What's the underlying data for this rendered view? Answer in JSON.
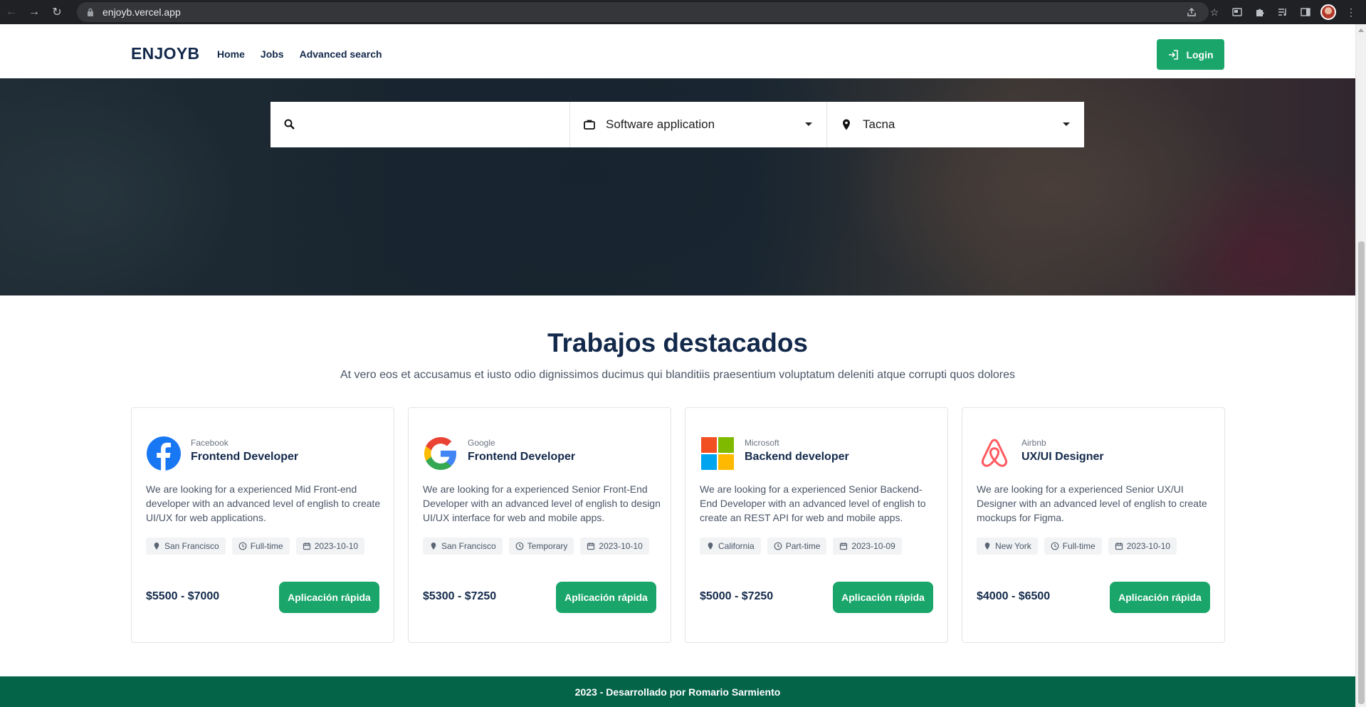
{
  "browser": {
    "url": "enjoyb.vercel.app",
    "icons": [
      "back-icon",
      "forward-icon",
      "reload-icon",
      "lock-icon",
      "share-icon",
      "star-icon",
      "tab-icon",
      "extensions-icon",
      "media-icon",
      "sidebar-icon",
      "profile-avatar",
      "menu-icon"
    ]
  },
  "navbar": {
    "brand": "ENJOYB",
    "links": [
      "Home",
      "Jobs",
      "Advanced search"
    ],
    "login": "Login"
  },
  "search": {
    "keyword_placeholder": "",
    "category": "Software application",
    "location": "Tacna"
  },
  "featured": {
    "title": "Trabajos destacados",
    "subtitle": "At vero eos et accusamus et iusto odio dignissimos ducimus qui blanditiis praesentium voluptatum deleniti atque corrupti quos dolores"
  },
  "jobs": [
    {
      "company": "Facebook",
      "role": "Frontend Developer",
      "description": "We are looking for a experienced Mid Front-end developer with an advanced level of english to create UI/UX for web applications.",
      "location": "San Francisco",
      "type": "Full-time",
      "date": "2023-10-10",
      "salary": "$5500 - $7000",
      "apply": "Aplicación rápida",
      "logo": "facebook-logo"
    },
    {
      "company": "Google",
      "role": "Frontend Developer",
      "description": "We are looking for a experienced Senior Front-End Developer with an advanced level of english to design UI/UX interface for web and mobile apps.",
      "location": "San Francisco",
      "type": "Temporary",
      "date": "2023-10-10",
      "salary": "$5300 - $7250",
      "apply": "Aplicación rápida",
      "logo": "google-logo"
    },
    {
      "company": "Microsoft",
      "role": "Backend developer",
      "description": "We are looking for a experienced Senior Backend-End Developer with an advanced level of english to create an REST API for web and mobile apps.",
      "location": "California",
      "type": "Part-time",
      "date": "2023-10-09",
      "salary": "$5000 - $7250",
      "apply": "Aplicación rápida",
      "logo": "microsoft-logo"
    },
    {
      "company": "Airbnb",
      "role": "UX/UI Designer",
      "description": "We are looking for a experienced Senior UX/UI Designer with an advanced level of english to create mockups for Figma.",
      "location": "New York",
      "type": "Full-time",
      "date": "2023-10-10",
      "salary": "$4000 - $6500",
      "apply": "Aplicación rápida",
      "logo": "airbnb-logo"
    }
  ],
  "footer": {
    "text": "2023 - Desarrollado por Romario Sarmiento"
  },
  "colors": {
    "brand_green": "#1aa66b",
    "footer_green": "#046448",
    "navy": "#13294b"
  }
}
